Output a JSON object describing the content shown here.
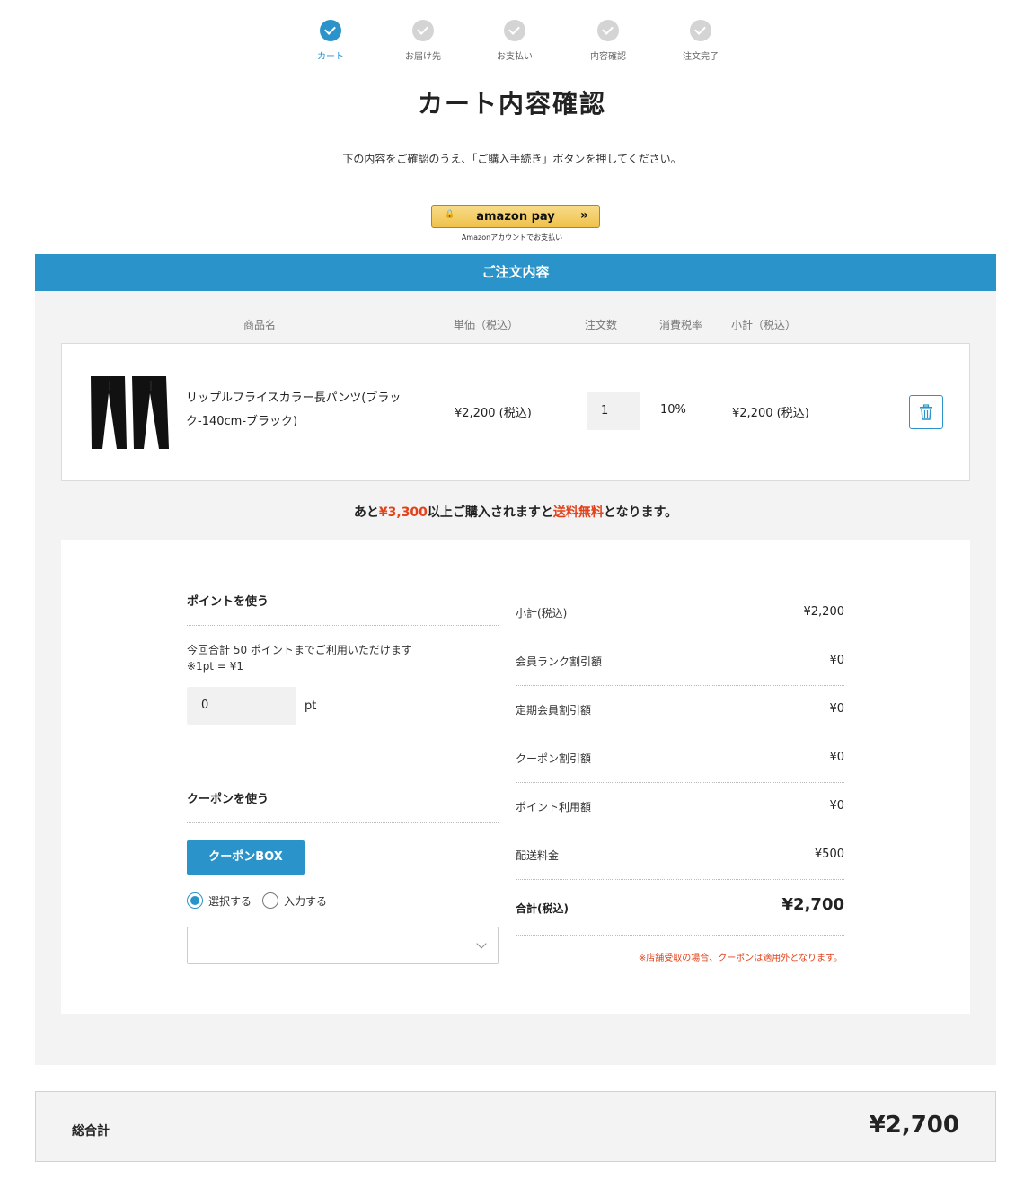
{
  "steps": [
    {
      "label": "カート",
      "active": true
    },
    {
      "label": "お届け先",
      "active": false
    },
    {
      "label": "お支払い",
      "active": false
    },
    {
      "label": "内容確認",
      "active": false
    },
    {
      "label": "注文完了",
      "active": false
    }
  ],
  "page": {
    "title": "カート内容確認",
    "description": "下の内容をご確認のうえ、「ご購入手続き」ボタンを押してください。"
  },
  "amazon": {
    "button_label": "amazon pay",
    "arrows": "»",
    "sub_label": "Amazonアカウントでお支払い"
  },
  "order": {
    "header": "ご注文内容",
    "columns": {
      "name": "商品名",
      "price": "単価（税込）",
      "qty": "注文数",
      "tax": "消費税率",
      "subtotal": "小計（税込）"
    },
    "item": {
      "name": "リップルフライスカラー長パンツ(ブラック-140cm-ブラック)",
      "price": "¥2,200 (税込)",
      "qty": "1",
      "tax": "10%",
      "subtotal": "¥2,200 (税込)",
      "trash_icon": "trash-icon"
    },
    "free_shipping": {
      "prefix": "あと",
      "amount": "¥3,300",
      "middle": "以上ご購入されますと",
      "highlight": "送料無料",
      "suffix": "となります。",
      "highlight_color": "#e2421b"
    }
  },
  "points": {
    "title": "ポイントを使う",
    "desc_line1": "今回合計 50 ポイントまでご利用いただけます",
    "desc_line2": "※1pt = ¥1",
    "value": "0",
    "unit": "pt"
  },
  "coupon": {
    "title": "クーポンを使う",
    "button_label": "クーポンBOX",
    "radio_select": "選択する",
    "radio_input": "入力する",
    "selected": "選択する",
    "select_value": ""
  },
  "summary": {
    "rows": [
      {
        "label": "小計(税込)",
        "value": "¥2,200"
      },
      {
        "label": "会員ランク割引額",
        "value": "¥0"
      },
      {
        "label": "定期会員割引額",
        "value": "¥0"
      },
      {
        "label": "クーポン割引額",
        "value": "¥0"
      },
      {
        "label": "ポイント利用額",
        "value": "¥0"
      },
      {
        "label": "配送料金",
        "value": "¥500"
      }
    ],
    "total_label": "合計(税込)",
    "total_value": "¥2,700",
    "note": "※店舗受取の場合、クーポンは適用外となります。"
  },
  "grand_total": {
    "label": "総合計",
    "value": "¥2,700"
  },
  "colors": {
    "accent": "#2a93c9",
    "highlight": "#e2421b",
    "step_inactive": "#d4d4d4",
    "amazon_button": "#f0c14b"
  }
}
